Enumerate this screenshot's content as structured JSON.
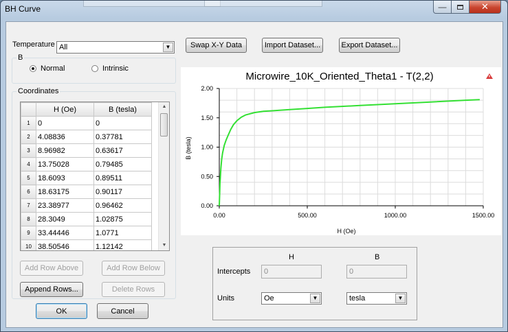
{
  "window": {
    "title": "BH Curve"
  },
  "temperature": {
    "label": "Temperature",
    "value": "All"
  },
  "b_group": {
    "title": "B",
    "options": [
      "Normal",
      "Intrinsic"
    ],
    "selected": "Normal"
  },
  "coordinates": {
    "title": "Coordinates",
    "columns": [
      "H (Oe)",
      "B (tesla)"
    ],
    "rows": [
      {
        "n": "1",
        "h": "0",
        "b": "0"
      },
      {
        "n": "2",
        "h": "4.08836",
        "b": "0.37781"
      },
      {
        "n": "3",
        "h": "8.96982",
        "b": "0.63617"
      },
      {
        "n": "4",
        "h": "13.75028",
        "b": "0.79485"
      },
      {
        "n": "5",
        "h": "18.6093",
        "b": "0.89511"
      },
      {
        "n": "6",
        "h": "18.63175",
        "b": "0.90117"
      },
      {
        "n": "7",
        "h": "23.38977",
        "b": "0.96462"
      },
      {
        "n": "8",
        "h": "28.3049",
        "b": "1.02875"
      },
      {
        "n": "9",
        "h": "33.44446",
        "b": "1.0771"
      },
      {
        "n": "10",
        "h": "38.50546",
        "b": "1.12142"
      }
    ]
  },
  "buttons": {
    "add_row_above": "Add Row Above",
    "add_row_below": "Add Row Below",
    "append_rows": "Append Rows...",
    "delete_rows": "Delete Rows",
    "ok": "OK",
    "cancel": "Cancel",
    "swap": "Swap X-Y Data",
    "import": "Import Dataset...",
    "export": "Export Dataset..."
  },
  "intercepts": {
    "col_h": "H",
    "col_b": "B",
    "label": "Intercepts",
    "h_value": "0",
    "b_value": "0",
    "units_label": "Units",
    "h_units": "Oe",
    "b_units": "tesla"
  },
  "colors": {
    "curve": "#33e033",
    "accent": "#3c7fb1"
  },
  "chart_data": {
    "type": "line",
    "title": "Microwire_10K_Oriented_Theta1 -  T(2,2)",
    "xlabel": "H (Oe)",
    "ylabel": "B (tesla)",
    "xlim": [
      0,
      1500
    ],
    "ylim": [
      0,
      2
    ],
    "x_ticks": [
      "0.00",
      "500.00",
      "1000.00",
      "1500.00"
    ],
    "y_ticks": [
      "0.00",
      "0.50",
      "1.00",
      "1.50",
      "2.00"
    ],
    "grid": true,
    "series": [
      {
        "x": [
          0,
          4.09,
          8.97,
          13.75,
          18.63,
          23.39,
          28.3,
          33.44,
          38.51,
          50,
          65,
          80,
          100,
          125,
          150,
          200,
          250,
          300,
          400,
          500,
          600,
          800,
          1000,
          1200,
          1400,
          1480
        ],
        "y": [
          0,
          0.378,
          0.636,
          0.795,
          0.901,
          0.965,
          1.029,
          1.077,
          1.121,
          1.2,
          1.3,
          1.38,
          1.45,
          1.51,
          1.55,
          1.59,
          1.61,
          1.62,
          1.64,
          1.66,
          1.68,
          1.71,
          1.74,
          1.77,
          1.8,
          1.81
        ]
      }
    ]
  }
}
